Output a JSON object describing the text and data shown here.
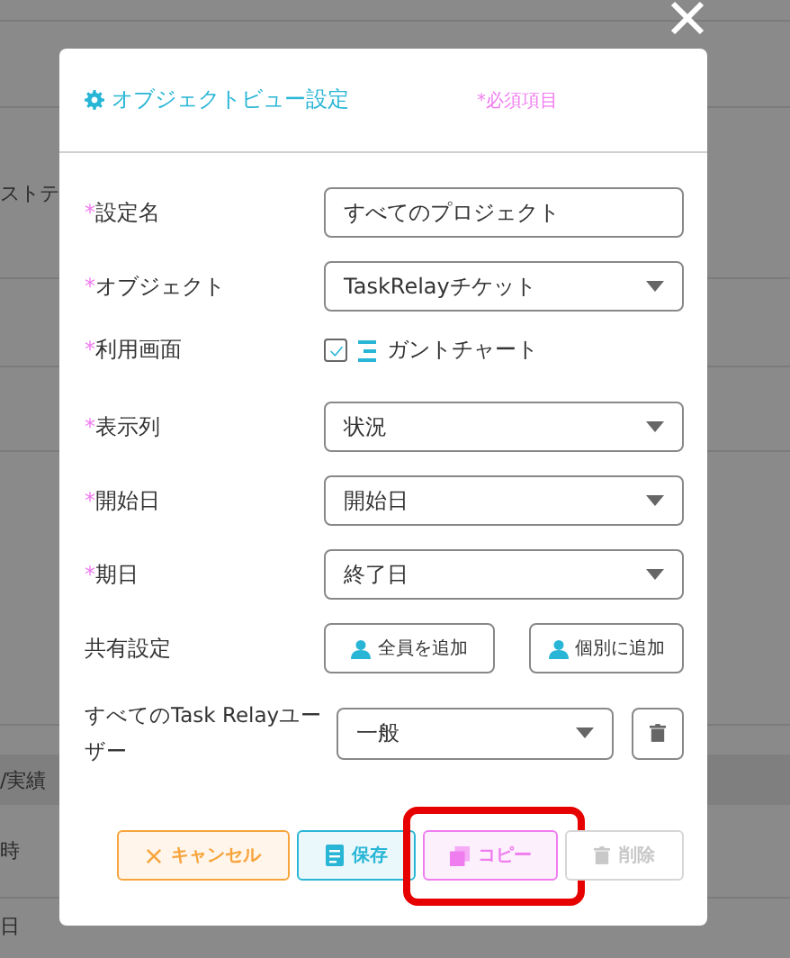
{
  "background": {
    "rows": [
      {
        "text": "ストテ"
      },
      {
        "text": "/実績"
      },
      {
        "text": "時"
      },
      {
        "text": "日"
      }
    ]
  },
  "modal": {
    "title": "オブジェクトビュー設定",
    "required_note": "*必須項目",
    "required_mark": "*",
    "fields": [
      {
        "kind": "text",
        "label": "設定名",
        "required": true,
        "value": "すべてのプロジェクト"
      },
      {
        "kind": "select",
        "label": "オブジェクト",
        "required": true,
        "value": "TaskRelayチケット"
      },
      {
        "kind": "checkbox",
        "label": "利用画面",
        "required": true,
        "checked": true,
        "option": "ガントチャート"
      },
      {
        "kind": "select",
        "label": "表示列",
        "required": true,
        "value": "状況"
      },
      {
        "kind": "select",
        "label": "開始日",
        "required": true,
        "value": "開始日"
      },
      {
        "kind": "select",
        "label": "期日",
        "required": true,
        "value": "終了日"
      },
      {
        "kind": "share",
        "label": "共有設定",
        "required": false,
        "buttons": [
          "全員を追加",
          "個別に追加"
        ]
      },
      {
        "kind": "role",
        "label": "すべてのTask Relayユーザー",
        "required": false,
        "value": "一般"
      }
    ],
    "buttons": [
      {
        "kind": "cancel",
        "label": "キャンセル",
        "disabled": false,
        "highlighted": false
      },
      {
        "kind": "save",
        "label": "保存",
        "disabled": false,
        "highlighted": false
      },
      {
        "kind": "copy",
        "label": "コピー",
        "disabled": false,
        "highlighted": true
      },
      {
        "kind": "delete",
        "label": "削除",
        "disabled": true,
        "highlighted": false
      }
    ]
  }
}
